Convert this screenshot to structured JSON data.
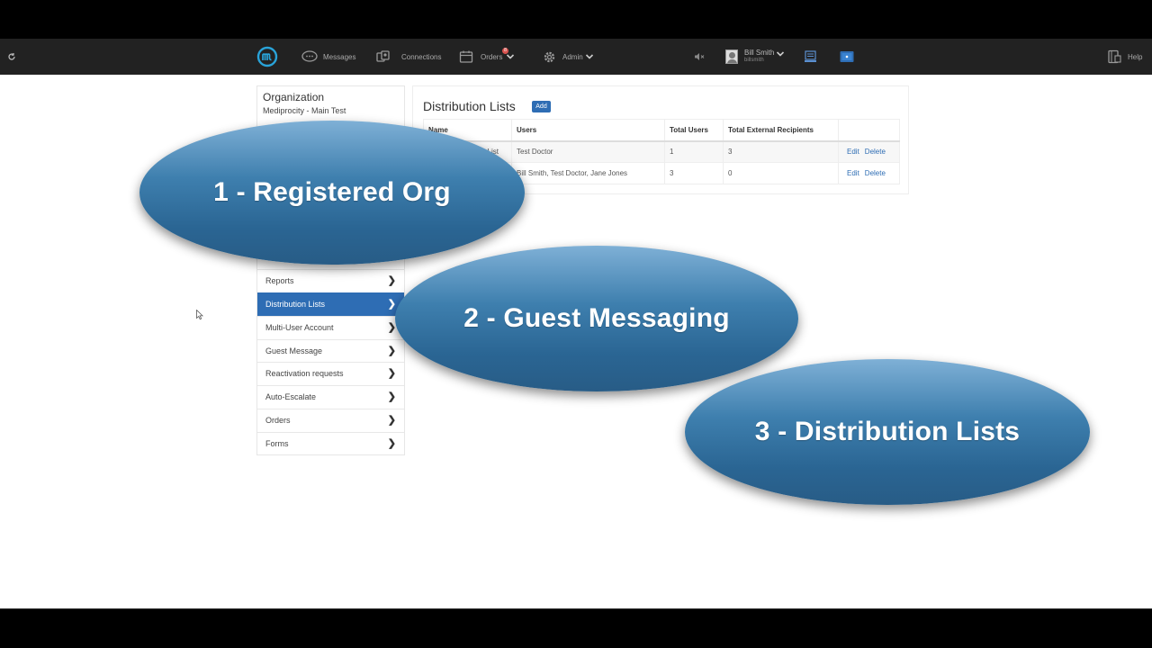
{
  "navbar": {
    "messages_label": "Messages",
    "connections_label": "Connections",
    "orders_label": "Orders",
    "orders_badge": "8",
    "admin_label": "Admin",
    "user_name": "Bill Smith",
    "user_handle": "billsmith",
    "help_label": "Help"
  },
  "sidebar": {
    "org_title": "Organization",
    "org_name": "Mediprocity - Main Test",
    "items": [
      {
        "label": "Reports"
      },
      {
        "label": "Distribution Lists"
      },
      {
        "label": "Multi-User Account"
      },
      {
        "label": "Guest Message"
      },
      {
        "label": "Reactivation requests"
      },
      {
        "label": "Auto-Escalate"
      },
      {
        "label": "Orders"
      },
      {
        "label": "Forms"
      }
    ]
  },
  "main": {
    "title": "Distribution Lists",
    "add_label": "Add",
    "columns": [
      "Name",
      "Users",
      "Total Users",
      "Total External Recipients"
    ],
    "rows": [
      {
        "name": "List",
        "users": "Test Doctor",
        "total_users": "1",
        "external": "3",
        "edit": "Edit",
        "delete": "Delete"
      },
      {
        "name": "",
        "users": "Bill Smith,  Test Doctor,  Jane Jones",
        "total_users": "3",
        "external": "0",
        "edit": "Edit",
        "delete": "Delete"
      }
    ]
  },
  "overlays": {
    "one": "1 - Registered Org",
    "two": "2 - Guest Messaging",
    "three": "3 - Distribution Lists"
  },
  "colors": {
    "accent": "#2e6db4",
    "navbar": "#222222",
    "logo": "#29a3d9"
  }
}
